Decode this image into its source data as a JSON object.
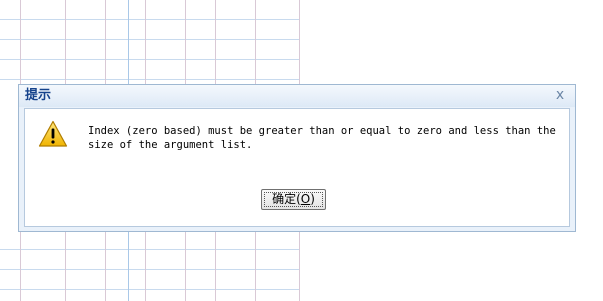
{
  "dialog": {
    "title": "提示",
    "close_glyph": "x",
    "icon": "warning-icon",
    "message": "Index (zero based) must be greater than or equal to zero and less than the size of the argument list.",
    "ok_label_prefix": "确定(",
    "ok_label_key": "O",
    "ok_label_suffix": ")"
  },
  "colors": {
    "title_text": "#15428b",
    "dialog_frame": "#e9f1fa",
    "grid_red": "#e6b8c8",
    "grid_blue": "#b9d3ec",
    "warning_yellow": "#f5c518"
  }
}
